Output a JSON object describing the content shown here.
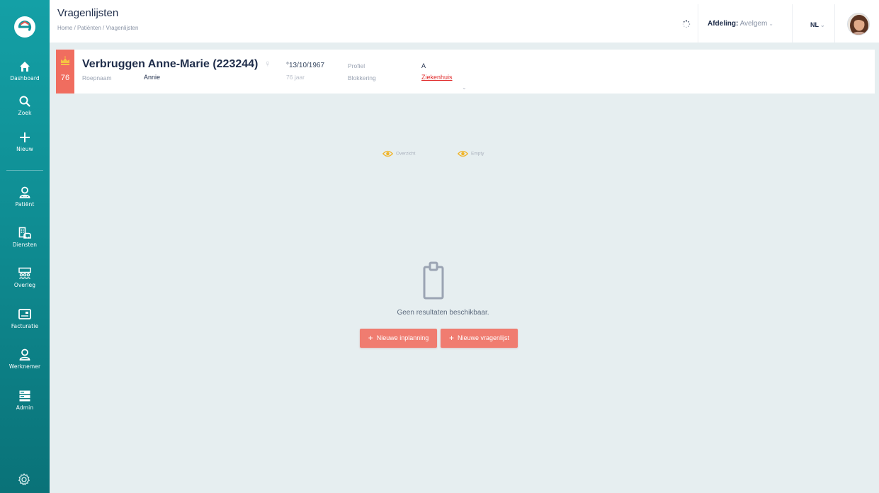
{
  "header": {
    "title": "Vragenlijsten",
    "breadcrumb": "Home / Patiënten / Vragenlijsten",
    "department_label": "Afdeling:",
    "department_value": "Avelgem",
    "language": "NL"
  },
  "sidebar": {
    "items": [
      {
        "label": "Dashboard",
        "icon": "home-icon"
      },
      {
        "label": "Zoek",
        "icon": "search-icon"
      },
      {
        "label": "Nieuw",
        "icon": "plus-icon"
      },
      {
        "label": "Patiënt",
        "icon": "patient-icon"
      },
      {
        "label": "Diensten",
        "icon": "services-icon"
      },
      {
        "label": "Overleg",
        "icon": "meeting-icon"
      },
      {
        "label": "Facturatie",
        "icon": "invoice-icon"
      },
      {
        "label": "Werknemer",
        "icon": "employee-icon"
      },
      {
        "label": "Admin",
        "icon": "admin-icon"
      }
    ]
  },
  "patient": {
    "age_badge": "76",
    "name": "Verbruggen Anne-Marie (223244)",
    "nickname_label": "Roepnaam",
    "nickname": "Annie",
    "dob": "°13/10/1967",
    "age_text": "76 jaar",
    "profile_label": "Profiel",
    "profile_value": "A",
    "blocking_label": "Blokkering",
    "blocking_value": "Ziekenhuis"
  },
  "toggles": {
    "overview": "Overzicht",
    "empty": "Empty"
  },
  "empty_state": {
    "message": "Geen resultaten beschikbaar.",
    "btn_new_planning": "Nieuwe inplanning",
    "btn_new_questionnaire": "Nieuwe vragenlijst"
  },
  "colors": {
    "sidebar": "#11959b",
    "accent": "#f07c70",
    "badge": "#f06d5f",
    "danger_link": "#e02b2b",
    "background": "#e6eef0"
  }
}
